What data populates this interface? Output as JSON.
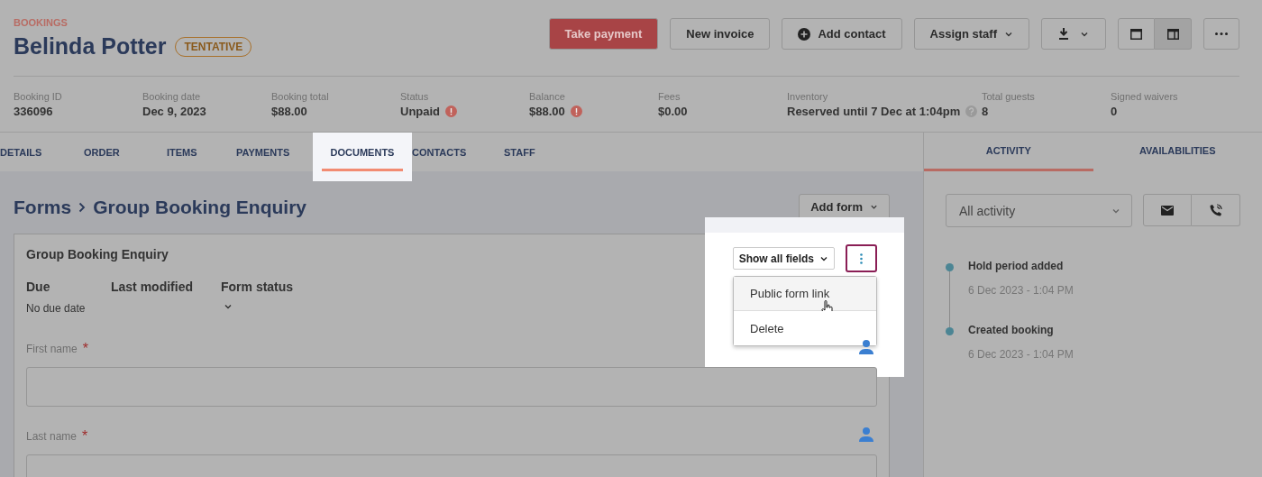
{
  "header": {
    "breadcrumb": "BOOKINGS",
    "title": "Belinda Potter",
    "badge": "TENTATIVE",
    "actions": [
      {
        "kind": "primary",
        "label": "Take payment"
      },
      {
        "kind": "plain",
        "label": "New invoice"
      },
      {
        "kind": "add",
        "label": "Add contact"
      },
      {
        "kind": "dropdown",
        "label": "Assign staff"
      },
      {
        "kind": "download"
      }
    ],
    "layout_toggle": [
      {
        "selected": false
      },
      {
        "selected": true
      }
    ]
  },
  "stats": [
    {
      "label": "Booking ID",
      "value": "336096"
    },
    {
      "label": "Booking date",
      "value": "Dec 9, 2023"
    },
    {
      "label": "Booking total",
      "value": "$88.00"
    },
    {
      "label": "Status",
      "value": "Unpaid",
      "alert": true
    },
    {
      "label": "Balance",
      "value": "$88.00",
      "alert": true
    },
    {
      "label": "Fees",
      "value": "$0.00"
    },
    {
      "label": "Inventory",
      "value": "Reserved until 7 Dec at 1:04pm",
      "help": true
    },
    {
      "label": "Total guests",
      "value": "8"
    },
    {
      "label": "Signed waivers",
      "value": "0"
    }
  ],
  "tabs": [
    {
      "label": "DETAILS",
      "selected": false
    },
    {
      "label": "ORDER",
      "selected": false
    },
    {
      "label": "ITEMS",
      "selected": false
    },
    {
      "label": "PAYMENTS",
      "selected": false
    },
    {
      "label": "DOCUMENTS",
      "selected": true
    },
    {
      "label": "CONTACTS",
      "selected": false
    },
    {
      "label": "STAFF",
      "selected": false
    }
  ],
  "section": {
    "crumbs": [
      "Forms",
      "Group Booking Enquiry"
    ],
    "add_button": "Add form"
  },
  "form": {
    "title": "Group Booking Enquiry",
    "show_fields": "Show all fields",
    "menu": [
      {
        "label": "Public form link",
        "hovered": true
      },
      {
        "label": "Delete",
        "hovered": false
      }
    ],
    "meta": [
      {
        "label": "Due",
        "value": "No due date"
      },
      {
        "label": "Last modified"
      },
      {
        "label": "Form status",
        "dropdown": true
      }
    ],
    "fields": [
      {
        "label": "First name",
        "required_mark": "*"
      },
      {
        "label": "Last name",
        "required_mark": "*"
      }
    ]
  },
  "side_tabs": [
    {
      "label": "ACTIVITY",
      "selected": true
    },
    {
      "label": "AVAILABILITIES",
      "selected": false
    }
  ],
  "activity": {
    "filter": "All activity",
    "events": [
      {
        "title": "Hold period added",
        "time": "6 Dec 2023 - 1:04 PM"
      },
      {
        "title": "Created booking",
        "time": "6 Dec 2023 - 1:04 PM"
      }
    ]
  }
}
